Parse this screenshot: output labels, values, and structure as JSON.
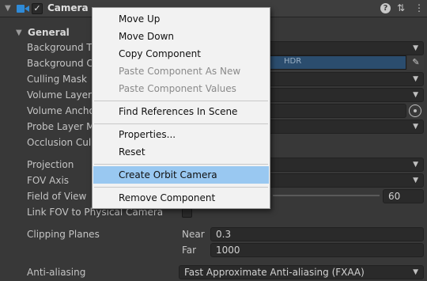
{
  "component": {
    "title": "Camera",
    "enabled_check": "✓",
    "fold_glyph": "▼",
    "icons": [
      "camera-icon",
      "help-icon",
      "preset-icon",
      "more-icon"
    ],
    "help_glyph": "?",
    "preset_glyph": "⇅",
    "more_glyph": "⋮"
  },
  "section": {
    "fold_glyph": "▼",
    "label": "General"
  },
  "rows": {
    "background_type": "Background T",
    "background_color": "Background C",
    "culling_mask": "Culling Mask",
    "volume_layer": "Volume Layer",
    "volume_anchor": "Volume Ancho",
    "probe_layer": "Probe Layer M",
    "occlusion": "Occlusion Cull",
    "projection": "Projection",
    "fov_axis": "FOV Axis",
    "field_of_view": "Field of View",
    "link_fov": "Link FOV to Physical Camera",
    "clipping_planes": "Clipping Planes",
    "anti_aliasing": "Anti-aliasing"
  },
  "values": {
    "hdr_label": "HDR",
    "fov_value": "60",
    "near_label": "Near",
    "near_value": "0.3",
    "far_label": "Far",
    "far_value": "1000",
    "anti_aliasing_value": "Fast Approximate Anti-aliasing (FXAA)",
    "dropdown_arrow": "▼",
    "picker_glyph": "✎"
  },
  "context_menu": {
    "items": [
      {
        "label": "Move Up",
        "enabled": true
      },
      {
        "label": "Move Down",
        "enabled": true
      },
      {
        "label": "Copy Component",
        "enabled": true
      },
      {
        "label": "Paste Component As New",
        "enabled": false
      },
      {
        "label": "Paste Component Values",
        "enabled": false
      },
      {
        "label": "Find References In Scene",
        "enabled": true
      },
      {
        "label": "Properties...",
        "enabled": true
      },
      {
        "label": "Reset",
        "enabled": true
      },
      {
        "label": "Create Orbit Camera",
        "enabled": true,
        "highlighted": true
      },
      {
        "label": "Remove Component",
        "enabled": true
      }
    ]
  },
  "colors": {
    "background": "#383838",
    "menu_background": "#f2f2f2",
    "menu_highlight": "#99c8f1",
    "camera_icon": "#2f8bd8",
    "hdr_color_swatch": "#2b4d6e"
  }
}
